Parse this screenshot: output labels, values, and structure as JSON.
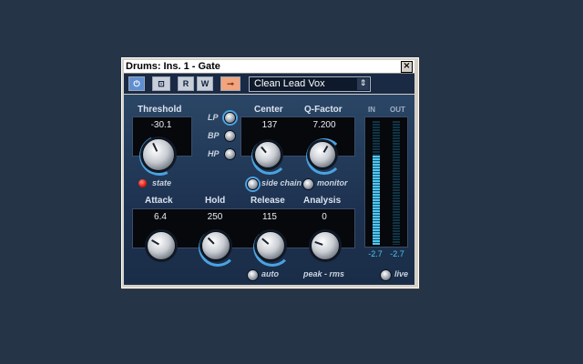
{
  "window": {
    "title": "Drums: Ins. 1 - Gate",
    "close_glyph": "×"
  },
  "toolbar": {
    "power_glyph": "⏻",
    "bypass_glyph": "⊡",
    "read_label": "R",
    "write_label": "W",
    "edit_glyph": "⊸",
    "preset": {
      "name": "Clean Lead Vox",
      "arrow_glyph": "⇕"
    }
  },
  "threshold": {
    "label": "Threshold",
    "value": "-30.1",
    "state_label": "state"
  },
  "filter": {
    "lp": "LP",
    "bp": "BP",
    "hp": "HP",
    "selected": "LP"
  },
  "center": {
    "label": "Center",
    "value": "137"
  },
  "qfactor": {
    "label": "Q-Factor",
    "value": "7.200"
  },
  "sidechain": {
    "label": "side chain"
  },
  "monitor": {
    "label": "monitor"
  },
  "attack": {
    "label": "Attack",
    "value": "6.4"
  },
  "hold": {
    "label": "Hold",
    "value": "250"
  },
  "release": {
    "label": "Release",
    "value": "115",
    "auto_label": "auto"
  },
  "analysis": {
    "label": "Analysis",
    "value": "0",
    "mode_label": "peak - rms"
  },
  "meters": {
    "in_label": "IN",
    "out_label": "OUT",
    "in_value": "-2.7",
    "out_value": "-2.7",
    "in_level": 0.72,
    "out_level": 0.0,
    "live_label": "live"
  },
  "colors": {
    "accent_blue": "#4aa3e2",
    "meter_cyan": "#4fc7f0",
    "state_led": "#e01a10",
    "panel": "#1d3250"
  }
}
